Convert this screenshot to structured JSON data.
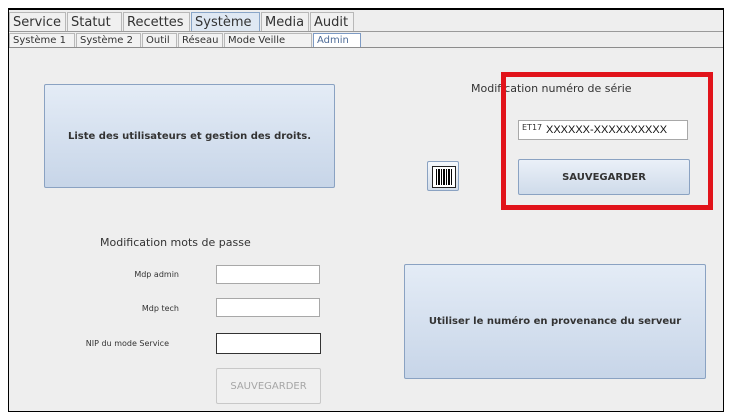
{
  "main_tabs": [
    {
      "label": "Service",
      "active": false
    },
    {
      "label": "Statut",
      "active": false
    },
    {
      "label": "Recettes",
      "active": false
    },
    {
      "label": "Système",
      "active": true
    },
    {
      "label": "Media",
      "active": false
    },
    {
      "label": "Audit",
      "active": false
    }
  ],
  "sub_tabs": [
    {
      "label": "Système 1",
      "active": false
    },
    {
      "label": "Système 2",
      "active": false
    },
    {
      "label": "Outil",
      "active": false
    },
    {
      "label": "Réseau",
      "active": false
    },
    {
      "label": "Mode Veille",
      "active": false
    },
    {
      "label": "Admin",
      "active": true
    }
  ],
  "users_button_label": "Liste des utilisateurs et gestion des droits.",
  "serial": {
    "heading": "Modification numéro de série",
    "prefix": "ET17",
    "value": "XXXXXX-XXXXXXXXXX",
    "save_label": "SAUVEGARDER",
    "barcode_icon": "barcode-icon"
  },
  "passwords": {
    "heading": "Modification mots de passe",
    "fields": [
      {
        "label": "Mdp admin",
        "value": ""
      },
      {
        "label": "Mdp tech",
        "value": ""
      },
      {
        "label": "NIP du mode Service",
        "value": ""
      }
    ],
    "save_label": "SAUVEGARDER"
  },
  "server_button_label": "Utiliser le numéro en provenance du serveur",
  "colors": {
    "highlight": "#e1131a",
    "button_gradient_top": "#e4ecf6",
    "button_gradient_bottom": "#c7d5e8"
  }
}
